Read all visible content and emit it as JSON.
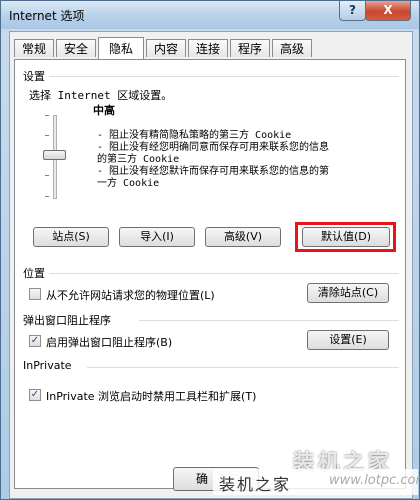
{
  "window": {
    "title": "Internet 选项",
    "help_glyph": "?",
    "close_glyph": "X"
  },
  "tabs": [
    {
      "label": "常规",
      "active": false
    },
    {
      "label": "安全",
      "active": false
    },
    {
      "label": "隐私",
      "active": true
    },
    {
      "label": "内容",
      "active": false
    },
    {
      "label": "连接",
      "active": false
    },
    {
      "label": "程序",
      "active": false
    },
    {
      "label": "高级",
      "active": false
    }
  ],
  "settings": {
    "group_label": "设置",
    "prompt": "选择 Internet 区域设置。",
    "level_name": "中高",
    "slider_position": "中高",
    "descriptions": [
      "- 阻止没有精简隐私策略的第三方 Cookie",
      "- 阻止没有经您明确同意而保存可用来联系您的信息",
      "的第三方 Cookie",
      "- 阻止没有经您默许而保存可用来联系您的信息的第",
      "一方 Cookie"
    ],
    "buttons": {
      "sites": "站点(S)",
      "import": "导入(I)",
      "advanced": "高级(V)",
      "default": "默认值(D)"
    }
  },
  "location": {
    "group_label": "位置",
    "never_allow_label": "从不允许网站请求您的物理位置(L)",
    "never_allow_checked": false,
    "clear_sites_button": "清除站点(C)"
  },
  "popup": {
    "group_label": "弹出窗口阻止程序",
    "enable_label": "启用弹出窗口阻止程序(B)",
    "enable_checked": true,
    "settings_button": "设置(E)"
  },
  "inprivate": {
    "group_label": "InPrivate",
    "disable_label": "InPrivate 浏览启动时禁用工具栏和扩展(T)",
    "disable_checked": true
  },
  "footer": {
    "ok_partial": "确"
  },
  "watermark": {
    "brand_large": "装机之家",
    "brand_small": "装机之家",
    "url": "www.lotpc.com"
  },
  "colors": {
    "highlight_border": "#e8141a",
    "title_bar": "#bad2ea"
  }
}
